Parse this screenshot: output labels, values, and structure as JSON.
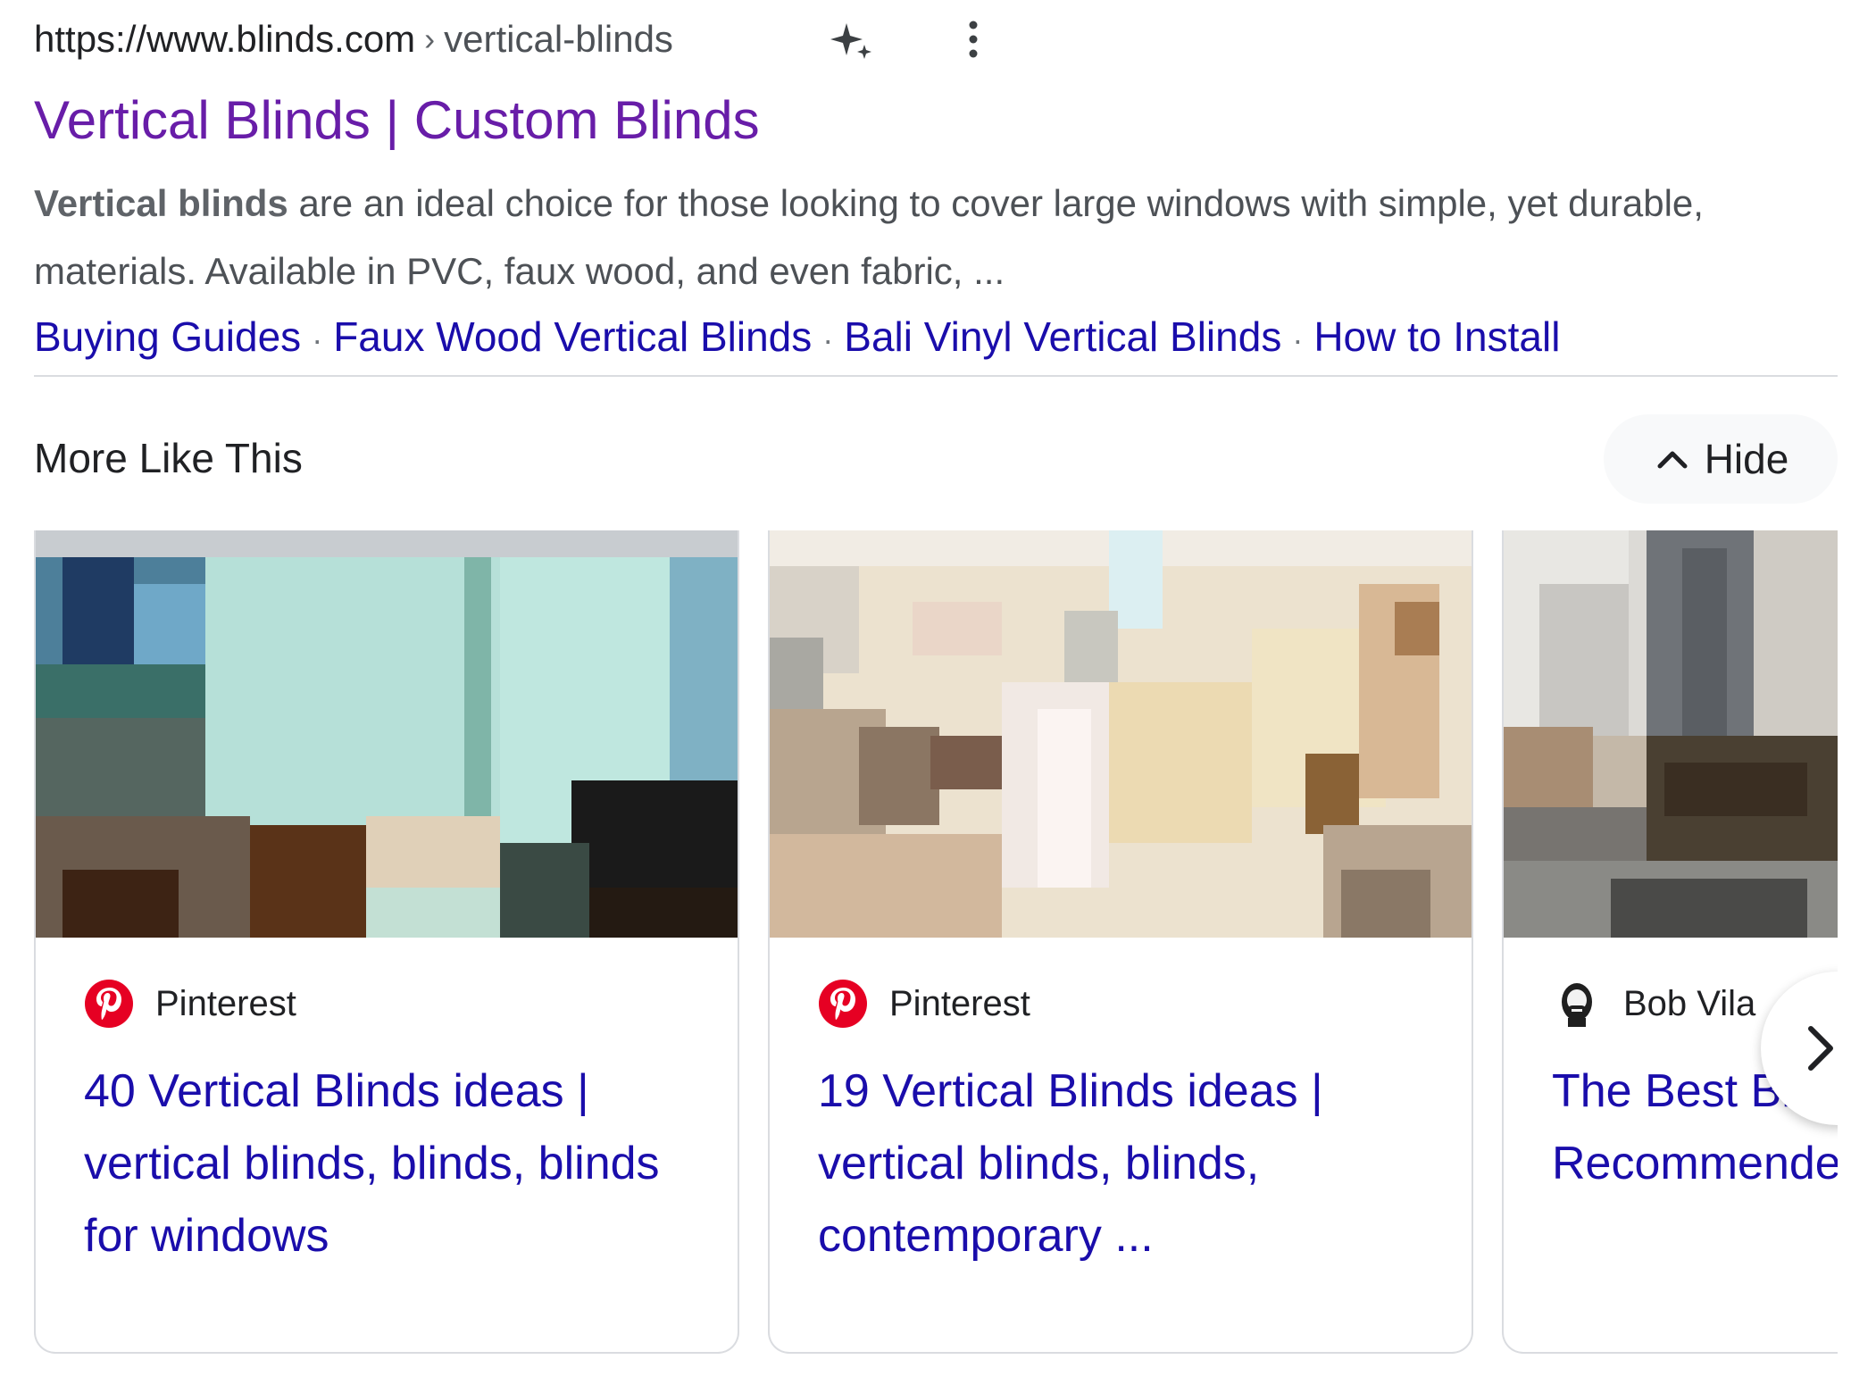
{
  "result": {
    "url_domain": "https://www.blinds.com",
    "url_separator": "›",
    "url_path": "vertical-blinds",
    "title": "Vertical Blinds | Custom Blinds",
    "snippet_bold": "Vertical blinds",
    "snippet_rest": " are an ideal choice for those looking to cover large windows with simple, yet durable, materials. Available in PVC, faux wood, and even fabric, ...",
    "sitelinks": [
      "Buying Guides",
      "Faux Wood Vertical Blinds",
      "Bali Vinyl Vertical Blinds",
      "How to Install"
    ],
    "sitelink_separator": "·"
  },
  "more_like_this": {
    "heading": "More Like This",
    "hide_label": "Hide",
    "cards": [
      {
        "source": "Pinterest",
        "source_icon": "pinterest-icon",
        "title": "40 Vertical Blinds ideas | vertical blinds, blinds, blinds for windows"
      },
      {
        "source": "Pinterest",
        "source_icon": "pinterest-icon",
        "title": "19 Vertical Blinds ideas | vertical blinds, blinds, contemporary ..."
      },
      {
        "source": "Bob Vila",
        "source_icon": "bob-vila-avatar-icon",
        "title": "The Best Blinds Recommended"
      }
    ]
  },
  "colors": {
    "visited_link": "#681da8",
    "link": "#1a0dab",
    "text": "#202124",
    "snippet": "#4d5156",
    "divider": "#dadce0",
    "pinterest_red": "#e60023"
  }
}
